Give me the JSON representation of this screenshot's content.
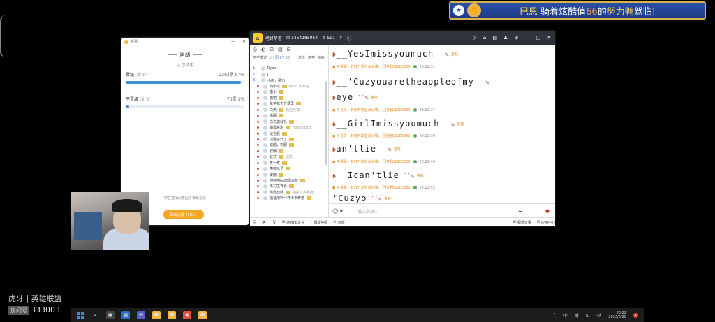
{
  "banner": {
    "prefix": "巴恩",
    "middle": " 骑着炫酷值",
    "value": "66",
    "suffix1": "的",
    "mount": "努力鸭",
    "suffix2": "驾临!"
  },
  "poll": {
    "window_title": "投票",
    "title": "晋级",
    "status": "已结束",
    "options": [
      {
        "name": "晋级",
        "quote": "发\"1\"",
        "count": "2263票 97%",
        "fraction": 0.97
      },
      {
        "name": "不晋级",
        "quote": "发\"2\"",
        "count": "70票 3%",
        "fraction": 0.03
      }
    ],
    "hint": "你在直播间发起了弹幕投票",
    "button": "再次设置（50s）"
  },
  "chat_window": {
    "title_name": "老好听着",
    "title_id": "1454185054",
    "title_count": "591",
    "tools": [
      "◎",
      "◐",
      "⊡",
      "▤",
      "⊟"
    ],
    "modes": [
      "查学模式",
      "√ 1图 07:08"
    ],
    "modes2": [
      "发送",
      "高亮",
      "精彩"
    ],
    "users": [
      {
        "idx": "1.",
        "name": "Ryan",
        "note": ""
      },
      {
        "idx": "2.",
        "name": "J",
        "note": ""
      },
      {
        "idx": "3.",
        "name": "小雨，夢力",
        "note": ""
      },
      {
        "idx": "",
        "name": "随小法",
        "note": "hello 大家好"
      },
      {
        "idx": "",
        "name": "猫小",
        "note": ""
      },
      {
        "idx": "",
        "name": "猫吧",
        "note": ""
      },
      {
        "idx": "",
        "name": "花子花王方便里",
        "note": ""
      },
      {
        "idx": "",
        "name": "白天",
        "note": "花边佳镇"
      },
      {
        "idx": "",
        "name": "白眠",
        "note": ""
      },
      {
        "idx": "",
        "name": "白鸟健壮礼",
        "note": ""
      },
      {
        "idx": "",
        "name": "谢霞良浏",
        "note": "http://jdkd"
      },
      {
        "idx": "",
        "name": "谜也我",
        "note": ""
      },
      {
        "idx": "",
        "name": "谜题子开了",
        "note": ""
      },
      {
        "idx": "",
        "name": "瑜题，权服",
        "note": ""
      },
      {
        "idx": "",
        "name": "钦朝",
        "note": ""
      },
      {
        "idx": "",
        "name": "钦才",
        "note": "迷影"
      },
      {
        "idx": "",
        "name": "笑一笑",
        "note": ""
      },
      {
        "idx": "",
        "name": "懂孩示予",
        "note": ""
      },
      {
        "idx": "",
        "name": "安南",
        "note": ""
      },
      {
        "idx": "",
        "name": "阿特叫tw率清远枝",
        "note": ""
      },
      {
        "idx": "",
        "name": "练习生神会",
        "note": ""
      },
      {
        "idx": "",
        "name": "阿曼健锅",
        "note": "温柔以多那度"
      },
      {
        "idx": "",
        "name": "福福地啊一杯卡布奇诺",
        "note": ""
      }
    ],
    "messages": [
      {
        "big": "__YesImissyoumuch",
        "gold": "金钱"
      },
      {
        "sys": "平哥哥 · 有效开发业余设带。 回复器(1203380)",
        "time": "23:22:31"
      },
      {
        "big": "__'Cuzyouaretheappleofmy",
        "gold": ""
      },
      {
        "big": "eye",
        "gold": "金钱"
      },
      {
        "sys": "平哥哥 · 有效开发业余设带。 回复器(1203380)",
        "time": "23:22:37"
      },
      {
        "big": "__GirlImissyoumuch",
        "gold": "金钱"
      },
      {
        "sys": "平哥哥 · 有效开发业余设带。 回复器(1203380)",
        "time": "23:22:39"
      },
      {
        "big": "an'tlie",
        "gold": "金钱"
      },
      {
        "sys": "平哥哥 · 有效开发业余设带。 回复器(1203380)",
        "time": "23:22:40"
      },
      {
        "big": "__Ican'tlie",
        "gold": "金钱"
      },
      {
        "sys": "平哥哥 · 有效开发业余设带。 回复器(1203380)",
        "time": "23:22:45"
      },
      {
        "big": "'Cuzyo",
        "gold": "金钱"
      }
    ],
    "input_placeholder": "输入你的...",
    "bottom": [
      "",
      "",
      "",
      "游戏FE发言",
      "播放停歌",
      "音频",
      "频道音量",
      "应用中心"
    ]
  },
  "stream": {
    "platform": "虎牙 | 英雄联盟",
    "room_label": "房间号",
    "room_number": "333003"
  },
  "taskbar": {
    "lang": "中",
    "ime": "拼",
    "time": "23:22",
    "date": "2023/6/28",
    "notif": "1"
  }
}
